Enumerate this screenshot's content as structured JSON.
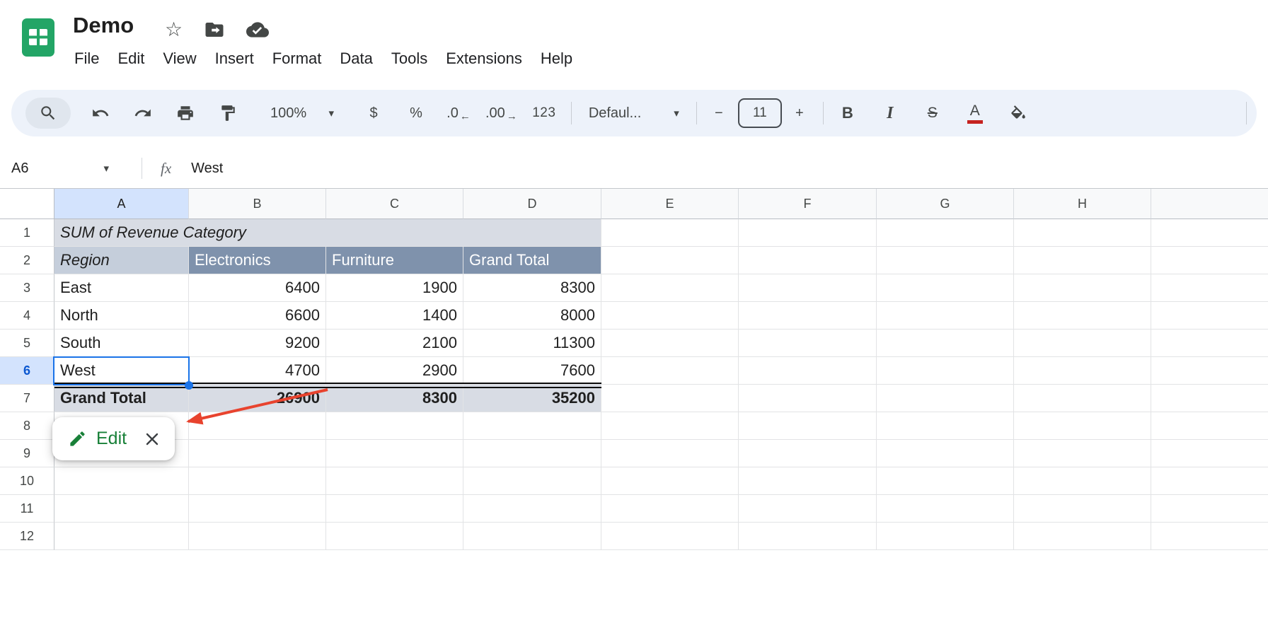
{
  "titlebar": {
    "title": "Demo",
    "menus": [
      "File",
      "Edit",
      "View",
      "Insert",
      "Format",
      "Data",
      "Tools",
      "Extensions",
      "Help"
    ]
  },
  "toolbar": {
    "zoom": "100%",
    "currency": "$",
    "percent": "%",
    "decrease_decimal": ".0",
    "increase_decimal": ".00",
    "more_formats": "123",
    "font_name": "Defaul...",
    "font_size": "11",
    "bold": "B",
    "italic": "I",
    "strikethrough": "S",
    "text_color": "A"
  },
  "icons": {
    "star": "☆",
    "caret": "▾",
    "minus": "−",
    "plus": "+",
    "arrow_left": "←",
    "arrow_right": "→"
  },
  "formula_bar": {
    "cell_ref": "A6",
    "fx": "fx",
    "value": "West"
  },
  "grid": {
    "col_headers": [
      "A",
      "B",
      "C",
      "D",
      "E",
      "F",
      "G",
      "H"
    ],
    "row_headers": [
      "1",
      "2",
      "3",
      "4",
      "5",
      "6",
      "7",
      "8",
      "9",
      "10",
      "11",
      "12"
    ],
    "selected_cell": "A6"
  },
  "pivot": {
    "title": "SUM of Revenue Category",
    "row_dim": "Region",
    "columns": [
      "Electronics",
      "Furniture",
      "Grand Total"
    ],
    "rows": [
      {
        "label": "East",
        "v0": "6400",
        "v1": "1900",
        "v2": "8300"
      },
      {
        "label": "North",
        "v0": "6600",
        "v1": "1400",
        "v2": "8000"
      },
      {
        "label": "South",
        "v0": "9200",
        "v1": "2100",
        "v2": "11300"
      },
      {
        "label": "West",
        "v0": "4700",
        "v1": "2900",
        "v2": "7600"
      }
    ],
    "grand_total": {
      "label": "Grand Total",
      "v0": "26900",
      "v1": "8300",
      "v2": "35200"
    }
  },
  "popup": {
    "edit": "Edit"
  },
  "colors": {
    "selection": "#1a73e8",
    "pivot_header": "#7f92ac",
    "pivot_subheader": "#c5cedb",
    "pivot_band": "#d8dce4",
    "edit_green": "#188038",
    "arrow_red": "#e8432e",
    "text_color_red": "#c5221f"
  }
}
